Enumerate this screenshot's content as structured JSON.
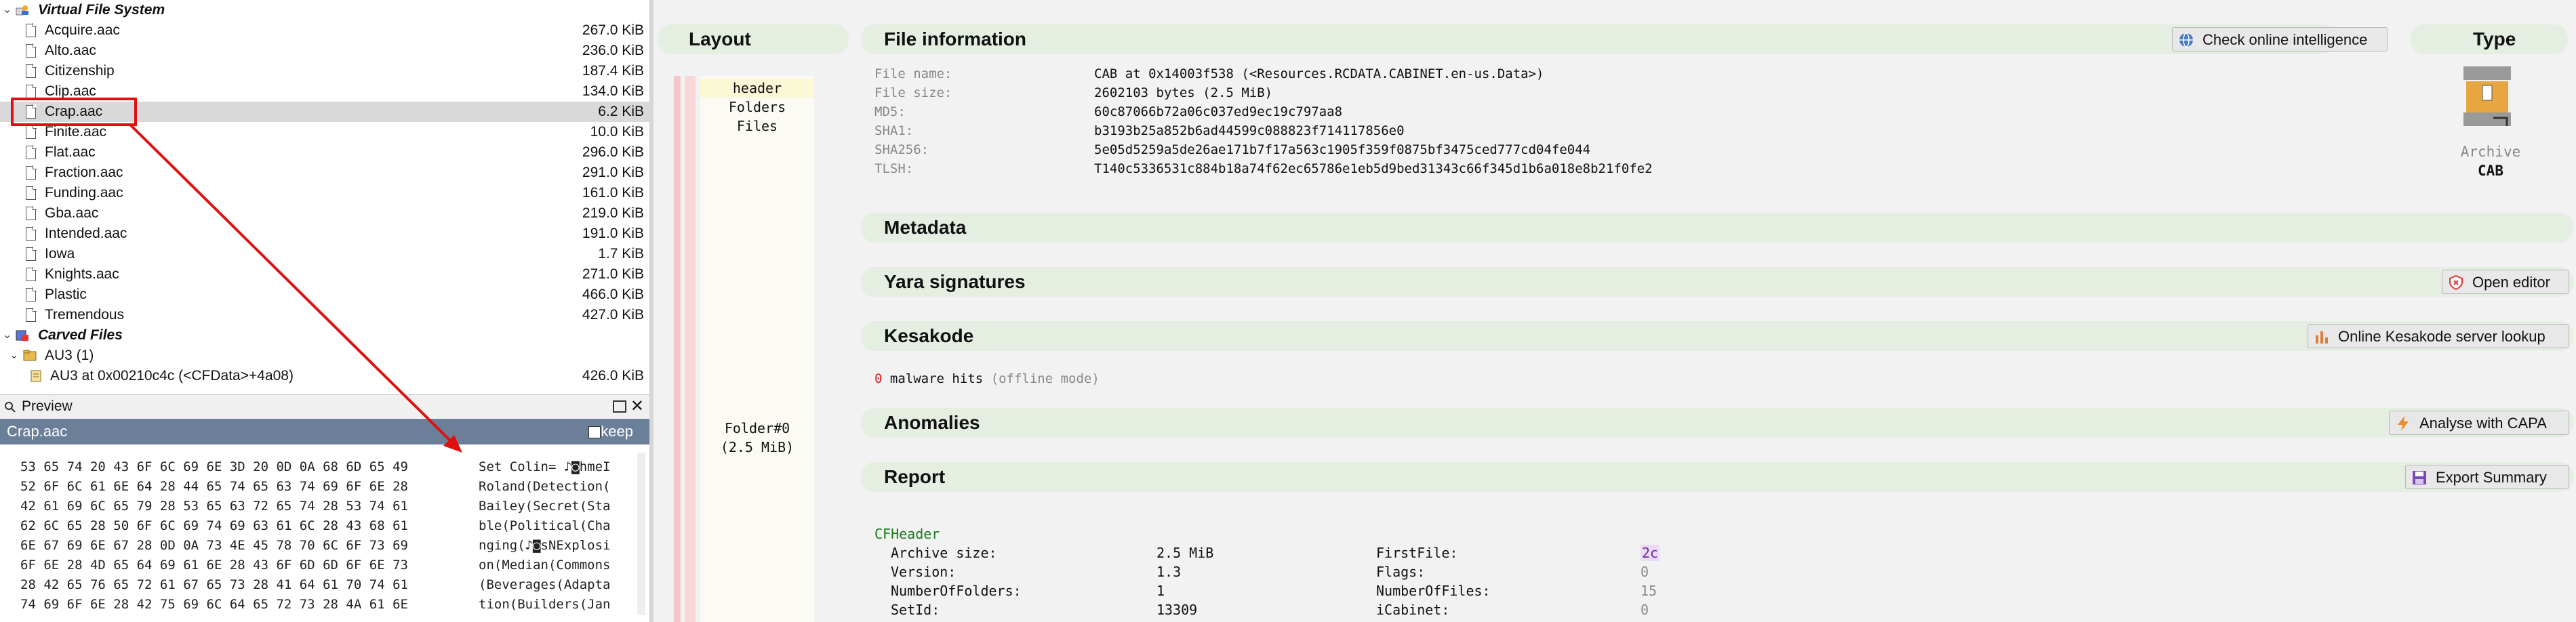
{
  "tree": {
    "root_label": "Virtual File System",
    "files": [
      {
        "name": "Acquire.aac",
        "size": "267.0 KiB"
      },
      {
        "name": "Alto.aac",
        "size": "236.0 KiB"
      },
      {
        "name": "Citizenship",
        "size": "187.4 KiB"
      },
      {
        "name": "Clip.aac",
        "size": "134.0 KiB"
      },
      {
        "name": "Crap.aac",
        "size": "6.2 KiB"
      },
      {
        "name": "Finite.aac",
        "size": "10.0 KiB"
      },
      {
        "name": "Flat.aac",
        "size": "296.0 KiB"
      },
      {
        "name": "Fraction.aac",
        "size": "291.0 KiB"
      },
      {
        "name": "Funding.aac",
        "size": "161.0 KiB"
      },
      {
        "name": "Gba.aac",
        "size": "219.0 KiB"
      },
      {
        "name": "Intended.aac",
        "size": "191.0 KiB"
      },
      {
        "name": "Iowa",
        "size": "1.7 KiB"
      },
      {
        "name": "Knights.aac",
        "size": "271.0 KiB"
      },
      {
        "name": "Plastic",
        "size": "466.0 KiB"
      },
      {
        "name": "Tremendous",
        "size": "427.0 KiB"
      }
    ],
    "carved_label": "Carved Files",
    "au3_label": "AU3 (1)",
    "au3_item": {
      "name": "AU3 at 0x00210c4c (<CFData>+4a08)",
      "size": "426.0 KiB"
    }
  },
  "preview": {
    "label": "Preview",
    "filename": "Crap.aac",
    "keep_label": "keep",
    "hex_lines": [
      "53 65 74 20 43 6F 6C 69 6E 3D 20 0D 0A 68 6D 65 49",
      "52 6F 6C 61 6E 64 28 44 65 74 65 63 74 69 6F 6E 28",
      "42 61 69 6C 65 79 28 53 65 63 72 65 74 28 53 74 61",
      "62 6C 65 28 50 6F 6C 69 74 69 63 61 6C 28 43 68 61",
      "6E 67 69 6E 67 28 0D 0A 73 4E 45 78 70 6C 6F 73 69",
      "6F 6E 28 4D 65 64 69 61 6E 28 43 6F 6D 6D 6F 6E 73",
      "28 42 65 76 65 72 61 67 65 73 28 41 64 61 70 74 61",
      "74 69 6F 6E 28 42 75 69 6C 64 65 72 73 28 4A 61 6E"
    ],
    "ascii_lines": [
      "Set Colin= ♪◙hmeI",
      "Roland(Detection(",
      "Bailey(Secret(Sta",
      "ble(Political(Cha",
      "nging(♪◙sNExplosi",
      "on(Median(Commons",
      "(Beverages(Adapta",
      "tion(Builders(Jan"
    ]
  },
  "layout_panel": {
    "title": "Layout",
    "items": [
      "header",
      "Folders",
      "Files"
    ],
    "folder_label": "Folder#0",
    "folder_size": "(2.5 MiB)"
  },
  "file_info": {
    "title": "File information",
    "check_btn": "Check online intelligence",
    "rows": [
      {
        "k": "File name:",
        "v": "CAB at 0x14003f538 (<Resources.RCDATA.CABINET.en-us.Data>)"
      },
      {
        "k": "File size:",
        "v": "2602103 bytes (2.5 MiB)"
      },
      {
        "k": "MD5:",
        "v": "60c87066b72a06c037ed9ec19c797aa8"
      },
      {
        "k": "SHA1:",
        "v": "b3193b25a852b6ad44599c088823f714117856e0"
      },
      {
        "k": "SHA256:",
        "v": "5e05d5259a5de26ae171b7f17a563c1905f359f0875bf3475ced777cd04fe044"
      },
      {
        "k": "TLSH:",
        "v": "T140c5336531c884b18a74f62ec65786e1eb5d9bed31343c66f345d1b6a018e8b21f0fe2"
      }
    ]
  },
  "type_panel": {
    "title": "Type",
    "kind": "Archive",
    "format": "CAB"
  },
  "sections": {
    "metadata": "Metadata",
    "yara": "Yara signatures",
    "yara_btn": "Open editor",
    "kesakode": "Kesakode",
    "kesakode_btn": "Online Kesakode server lookup",
    "kesakode_count": "0",
    "kesakode_text": "malware hits",
    "kesakode_mode": "(offline mode)",
    "anomalies": "Anomalies",
    "anomalies_btn": "Analyse with CAPA",
    "report": "Report",
    "report_btn": "Export Summary"
  },
  "cfheader": {
    "title": "CFHeader",
    "left": [
      {
        "k": "Archive size:",
        "v": "2.5 MiB"
      },
      {
        "k": "Version:",
        "v": "1.3"
      },
      {
        "k": "NumberOfFolders:",
        "v": "1"
      },
      {
        "k": "SetId:",
        "v": "13309"
      }
    ],
    "right": [
      {
        "k": "FirstFile:",
        "v": "2c"
      },
      {
        "k": "Flags:",
        "v": "0"
      },
      {
        "k": "NumberOfFiles:",
        "v": "15"
      },
      {
        "k": "iCabinet:",
        "v": "0"
      }
    ]
  },
  "colors": {
    "selection": "#d9d9d9",
    "band": "#e4efe2",
    "preview_header": "#6b7f99",
    "annotation_red": "#e01010",
    "cf_green": "#1a7a1a",
    "firstfile_bg": "#ecd9f5"
  }
}
